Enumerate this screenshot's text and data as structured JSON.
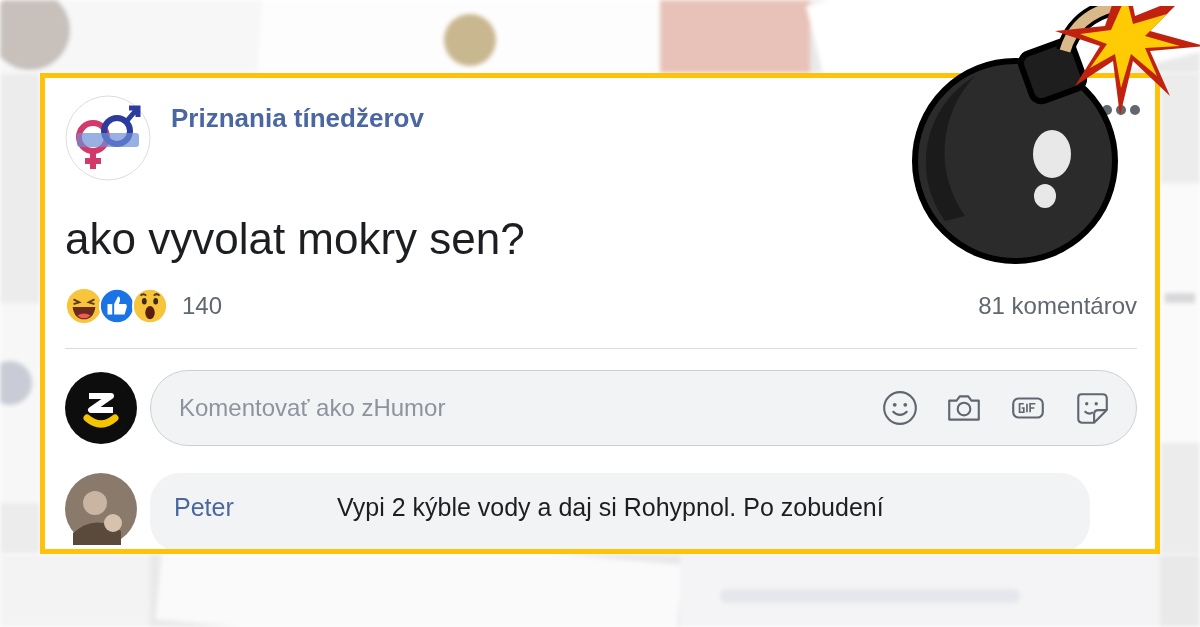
{
  "post": {
    "page_name": "Priznania tínedžerov",
    "text": "ako vyvolat mokry sen?",
    "reactions": [
      {
        "kind": "haha"
      },
      {
        "kind": "like"
      },
      {
        "kind": "wow"
      }
    ],
    "reaction_count": "140",
    "comment_count": "81 komentárov"
  },
  "composer": {
    "placeholder": "Komentovať ako zHumor"
  },
  "comments": [
    {
      "author": "Peter",
      "text": "Vypi 2 kýble vody a daj si Rohypnol. Po zobudení"
    }
  ]
}
